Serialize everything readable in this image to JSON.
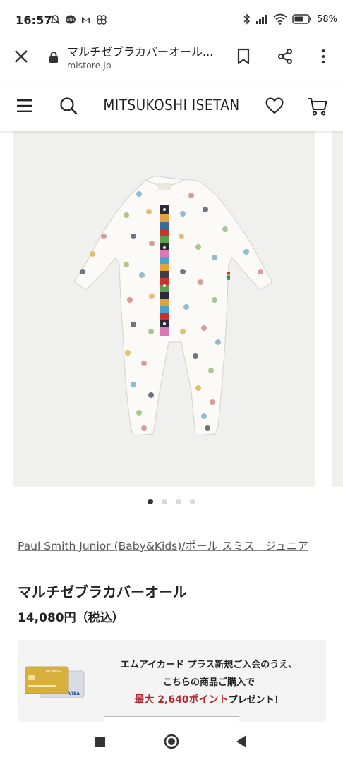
{
  "status_bar": {
    "time": "16:57",
    "battery_percent": "58%",
    "icons": [
      "mute-icon",
      "line-icon",
      "gmail-icon",
      "pinwheel-icon",
      "bluetooth-icon",
      "signal-icon",
      "wifi-icon",
      "battery-icon"
    ]
  },
  "browser": {
    "page_title": "マルチゼブラカバーオール...",
    "url": "mistore.jp",
    "icons": [
      "close-icon",
      "lock-icon",
      "bookmark-icon",
      "share-icon",
      "more-icon"
    ]
  },
  "site_header": {
    "brand": "MITSUKOSHI ISETAN",
    "icons": [
      "menu-icon",
      "search-icon",
      "heart-icon",
      "cart-icon"
    ]
  },
  "gallery": {
    "image_count": 4,
    "active_index": 0
  },
  "product": {
    "brand_link": "Paul Smith Junior (Baby&Kids)/ポール スミス　ジュニア",
    "name": "マルチゼブラカバーオール",
    "price": "14,080円（税込）"
  },
  "promo": {
    "line1": "エムアイカード プラス新規ご入会のうえ、",
    "line2": "こちらの商品ご購入で",
    "highlight": "最大 2,640ポイント",
    "line3_suffix": "プレゼント！",
    "card_label": "MICARD+",
    "card_network": "VISA"
  },
  "colors": {
    "promo_red": "#b0272d",
    "gallery_bg": "#f0f0ef",
    "dot_active": "#333333",
    "dot_inactive": "#d9d9d9"
  },
  "nav_bar": {
    "icons": [
      "recents-icon",
      "home-icon",
      "back-icon"
    ]
  }
}
